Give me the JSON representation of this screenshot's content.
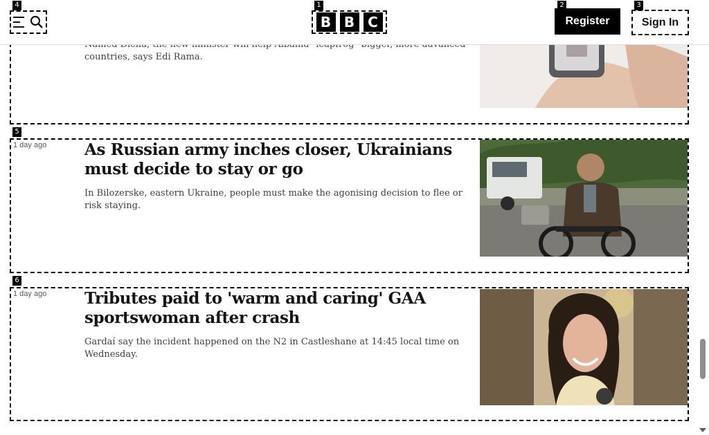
{
  "header": {
    "logo_letters": [
      "B",
      "B",
      "C"
    ],
    "register_label": "Register",
    "signin_label": "Sign In",
    "menu_icon": "hamburger-menu-icon",
    "search_icon": "search-icon"
  },
  "badges": {
    "logo": "1",
    "register": "2",
    "signin": "3",
    "menu": "4",
    "card2": "5",
    "card3": "6"
  },
  "articles": [
    {
      "timestamp": "",
      "headline": "",
      "summary": "Named Diella, the new minister will help Albania \"leapfrog\" bigger, more advanced countries, says Edi Rama."
    },
    {
      "timestamp": "1 day ago",
      "headline": "As Russian army inches closer, Ukrainians must decide to stay or go",
      "summary": "In Bilozerske, eastern Ukraine, people must make the agonising decision to flee or risk staying."
    },
    {
      "timestamp": "1 day ago",
      "headline": "Tributes paid to 'warm and caring' GAA sportswoman after crash",
      "summary": "Gardaí say the incident happened on the N2 in Castleshane at 14:45 local time on Wednesday."
    }
  ],
  "colors": {
    "brand": "#000000",
    "text": "#141414",
    "muted": "#545658"
  }
}
